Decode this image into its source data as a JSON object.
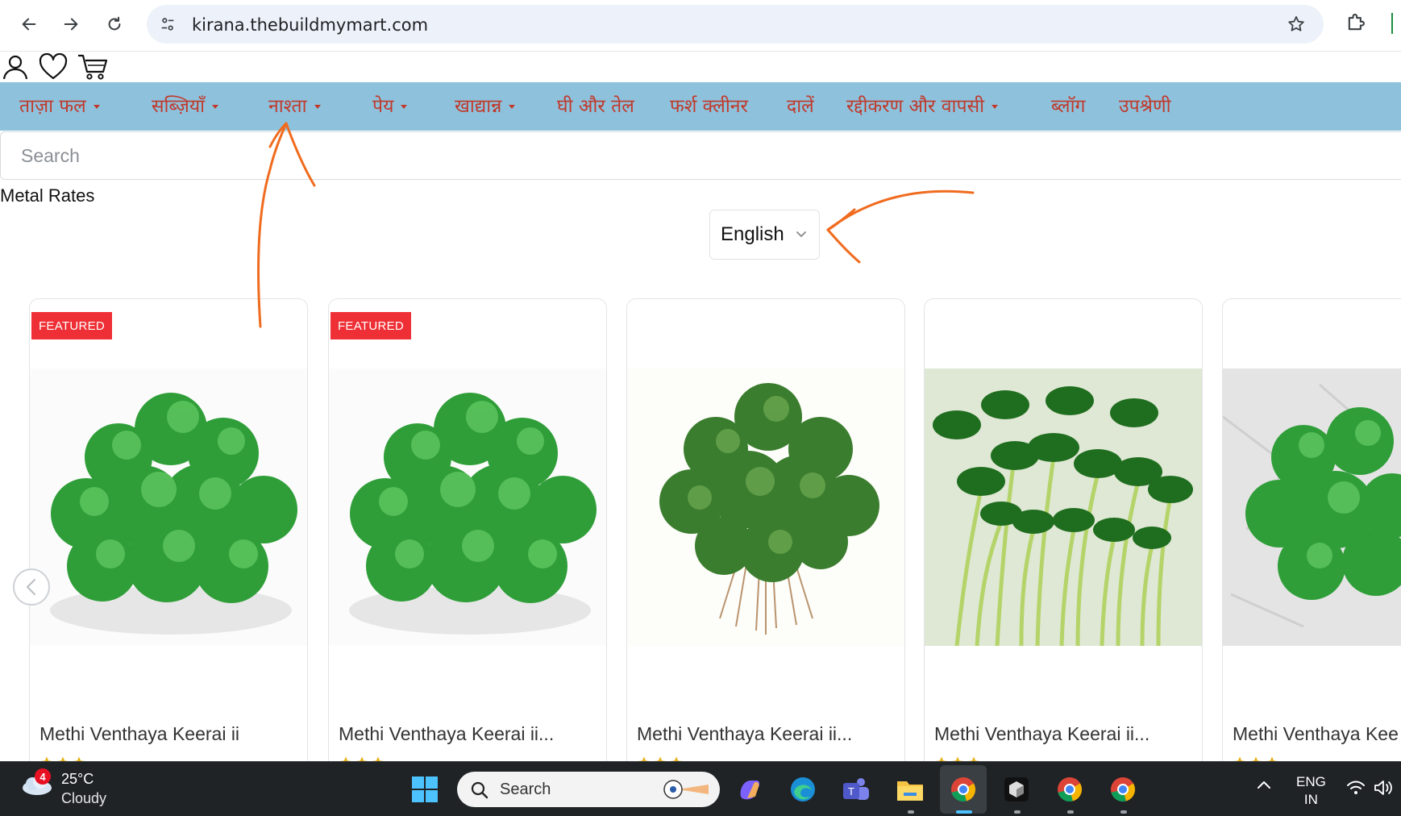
{
  "browser": {
    "url": "kirana.thebuildmymart.com",
    "icons": {
      "back": "arrow-left-icon",
      "forward": "arrow-right-icon",
      "reload": "reload-icon",
      "site_info": "tune-icon",
      "bookmark": "star-icon",
      "extensions": "puzzle-icon"
    }
  },
  "site_header": {
    "icons": [
      "user-icon",
      "heart-icon",
      "cart-icon"
    ]
  },
  "categories": [
    {
      "label": "ताज़ा फल",
      "dropdown": true
    },
    {
      "label": "सब्ज़ियाँ",
      "dropdown": true
    },
    {
      "label": "नाश्ता",
      "dropdown": true
    },
    {
      "label": "पेय",
      "dropdown": true
    },
    {
      "label": "खाद्यान्न",
      "dropdown": true
    },
    {
      "label": "घी और तेल",
      "dropdown": false
    },
    {
      "label": "फर्श क्लीनर",
      "dropdown": false
    },
    {
      "label": "दालें",
      "dropdown": false
    },
    {
      "label": "रद्दीकरण और वापसी",
      "dropdown": true
    },
    {
      "label": "ब्लॉग",
      "dropdown": false
    },
    {
      "label": "उपश्रेणी",
      "dropdown": false
    }
  ],
  "search": {
    "placeholder": "Search",
    "value": ""
  },
  "metal_rates_label": "Metal Rates",
  "language_select": {
    "selected": "English"
  },
  "products": [
    {
      "badge": "FEATURED",
      "title": "Methi Venthaya Keerai ii"
    },
    {
      "badge": "FEATURED",
      "title": "Methi Venthaya Keerai ii..."
    },
    {
      "badge": "",
      "title": "Methi Venthaya Keerai ii..."
    },
    {
      "badge": "",
      "title": "Methi Venthaya Keerai ii..."
    },
    {
      "badge": "",
      "title": "Methi Venthaya Kee"
    }
  ],
  "colors": {
    "nav_background": "#8ec2dc",
    "nav_text": "#c0392b",
    "badge": "#ee2f35",
    "annotation": "#f06b1e"
  },
  "taskbar": {
    "weather": {
      "temp": "25°C",
      "condition": "Cloudy",
      "notification_count": "4"
    },
    "search_label": "Search",
    "language": {
      "line1": "ENG",
      "line2": "IN"
    }
  }
}
